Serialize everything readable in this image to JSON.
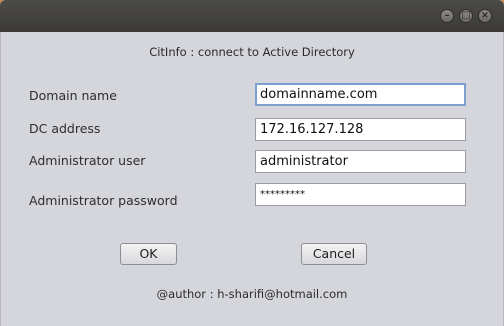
{
  "window": {
    "title": "",
    "controls": {
      "minimize": "minimize-icon",
      "maximize": "maximize-icon",
      "close": "close-icon"
    }
  },
  "dialog": {
    "heading": "CitInfo : connect to Active Directory",
    "fields": [
      {
        "label": "Domain name",
        "value": "domainname.com",
        "type": "text",
        "focused": true
      },
      {
        "label": "DC  address",
        "value": "172.16.127.128",
        "type": "text",
        "focused": false
      },
      {
        "label": "Administrator user",
        "value": "administrator",
        "type": "text",
        "focused": false
      },
      {
        "label": "Administrator password",
        "value": "*********",
        "type": "password",
        "focused": false
      }
    ],
    "ok_label": "OK",
    "cancel_label": "Cancel",
    "footer": "@author : h-sharifi@hotmail.com"
  },
  "colors": {
    "titlebar": "#3f3e3b",
    "dialog_background": "#d5d6db",
    "focus_border": "#7d9fd0"
  }
}
